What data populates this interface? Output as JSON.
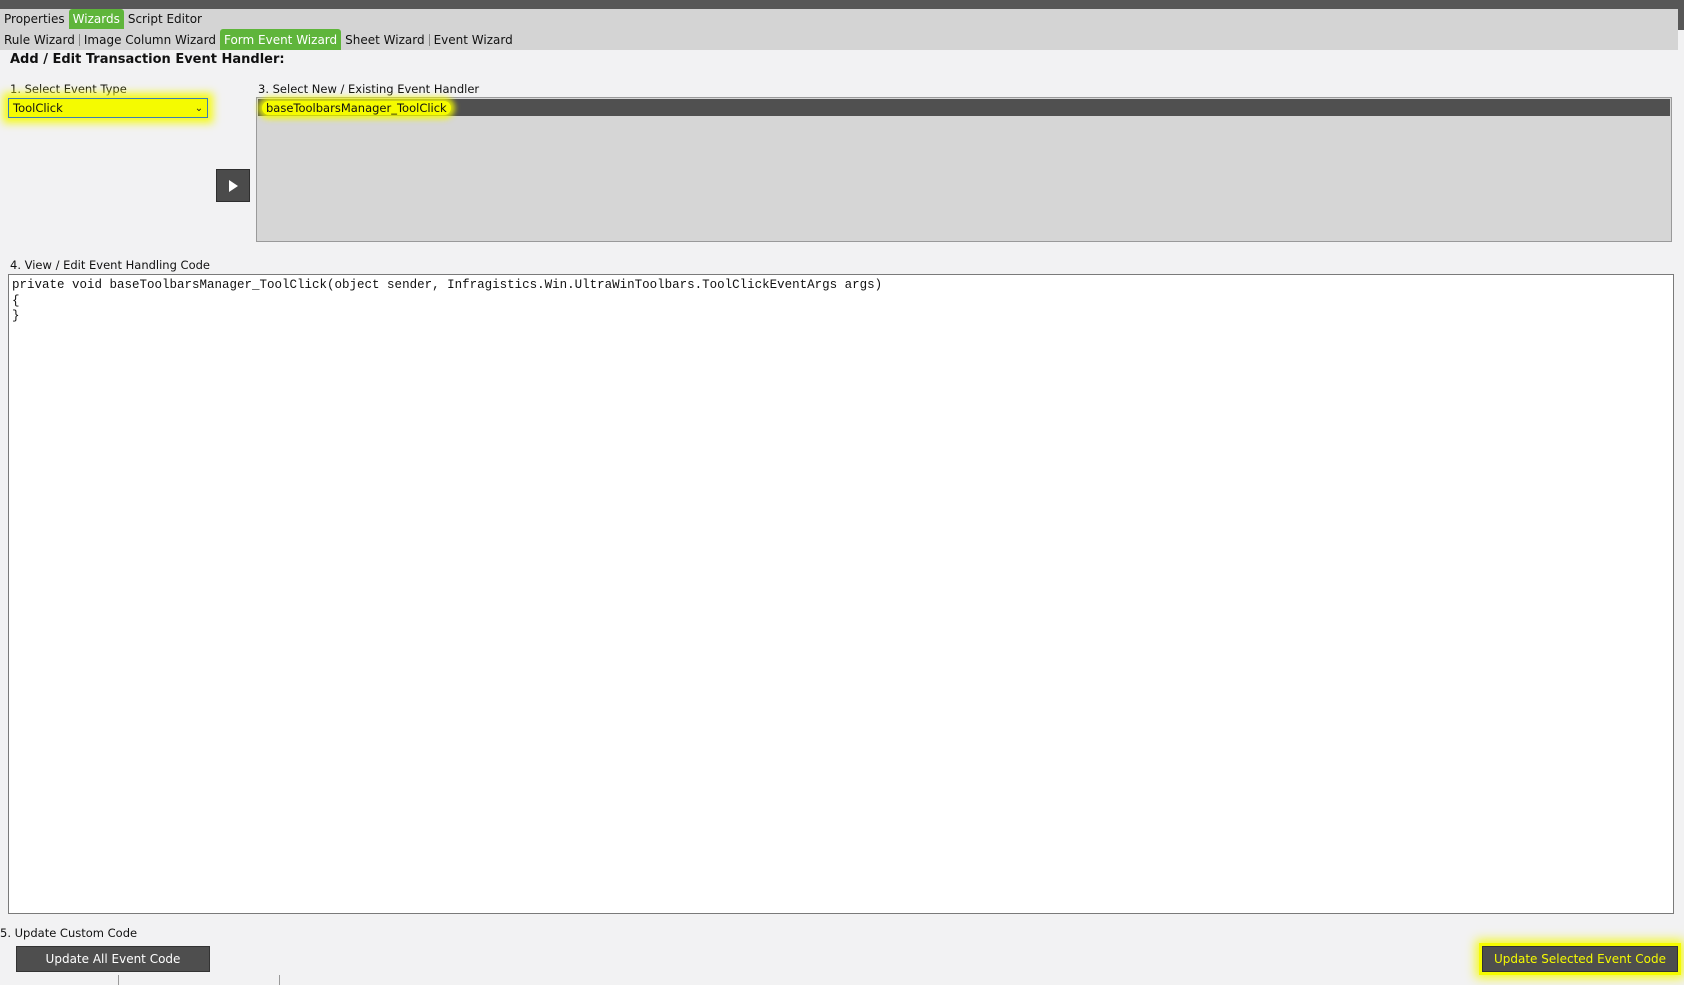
{
  "tabs_row1": [
    {
      "label": "Properties",
      "active": false
    },
    {
      "label": "Wizards",
      "active": true
    },
    {
      "label": "Script Editor",
      "active": false
    }
  ],
  "tabs_row2": [
    {
      "label": "Rule Wizard",
      "active": false
    },
    {
      "label": "Image Column Wizard",
      "active": false
    },
    {
      "label": "Form Event Wizard",
      "active": true
    },
    {
      "label": "Sheet Wizard",
      "active": false
    },
    {
      "label": "Event Wizard",
      "active": false
    }
  ],
  "heading": "Add / Edit Transaction Event Handler:",
  "step1": {
    "label": "1. Select Event Type",
    "selected": "ToolClick"
  },
  "step3": {
    "label": "3. Select New / Existing Event Handler",
    "items": [
      "baseToolbarsManager_ToolClick"
    ]
  },
  "step4": {
    "label": "4. View / Edit Event Handling Code",
    "code": "private void baseToolbarsManager_ToolClick(object sender, Infragistics.Win.UltraWinToolbars.ToolClickEventArgs args)\n{\n}"
  },
  "step5": {
    "label": "5. Update Custom Code",
    "update_all_label": "Update All Event Code",
    "update_selected_label": "Update Selected Event Code"
  },
  "colors": {
    "accent_green": "#5fb53b",
    "highlight": "#f5fb00",
    "dark_button": "#4e4e4e"
  }
}
